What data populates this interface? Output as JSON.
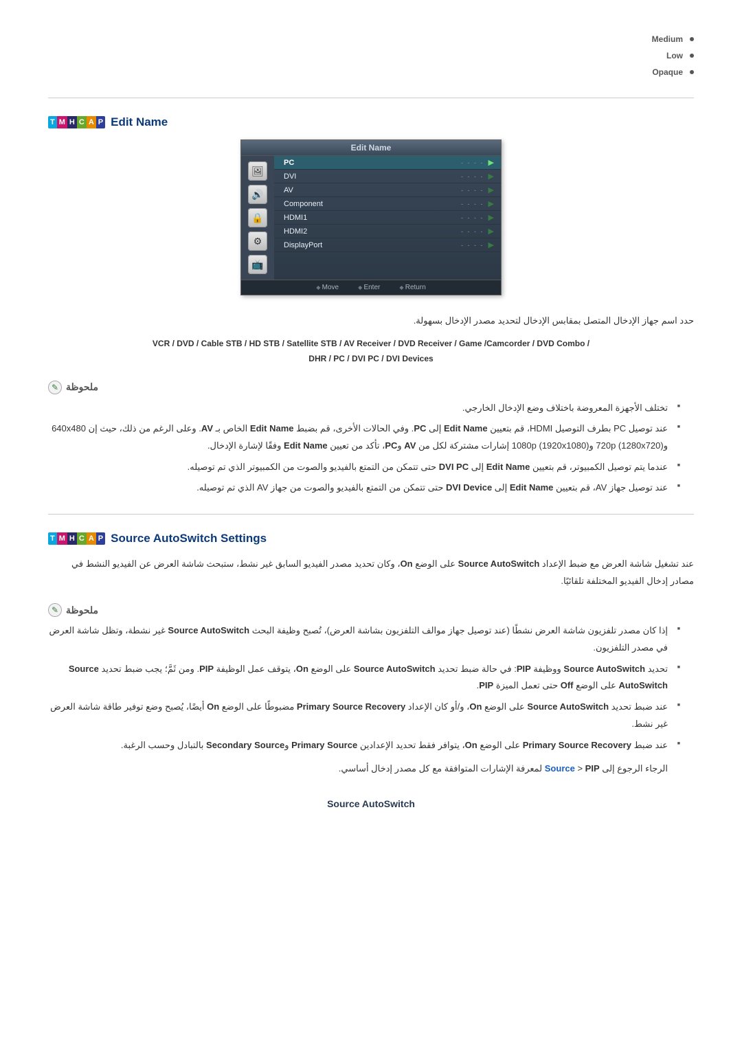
{
  "options": {
    "medium": "Medium",
    "low": "Low",
    "opaque": "Opaque"
  },
  "badges": {
    "t": "T",
    "m": "M",
    "h": "H",
    "c": "C",
    "a": "A",
    "p": "P"
  },
  "editName": {
    "title": "Edit Name",
    "osdTitle": "Edit Name",
    "rows": [
      {
        "name": "PC",
        "val": "- - - -"
      },
      {
        "name": "DVI",
        "val": "- - - -"
      },
      {
        "name": "AV",
        "val": "- - - -"
      },
      {
        "name": "Component",
        "val": "- - - -"
      },
      {
        "name": "HDMI1",
        "val": "- - - -"
      },
      {
        "name": "HDMI2",
        "val": "- - - -"
      },
      {
        "name": "DisplayPort",
        "val": "- - - -"
      }
    ],
    "foot": {
      "move": "Move",
      "enter": "Enter",
      "return": "Return"
    },
    "caption": "حدد اسم جهاز الإدخال المتصل بمقابس الإدخال لتحديد مصدر الإدخال بسهولة.",
    "devicesLine1": "VCR / DVD / Cable STB / HD STB / Satellite STB / AV Receiver / DVD Receiver / Game /Camcorder / DVD Combo /",
    "devicesLine2": "DHR / PC / DVI PC / DVI Devices"
  },
  "note1": {
    "label": "ملحوظة",
    "items": [
      "تختلف الأجهزة المعروضة باختلاف وضع الإدخال الخارجي.",
      "عند توصيل PC بطرف التوصيل HDMI، قم بتعيين <b>Edit Name</b> إلى <b>PC</b>. وفي الحالات الأخرى، قم بضبط <b>Edit Name</b> الخاص بـ <b>AV</b>. وعلى الرغم من ذلك، حيث إن 640x480 و(1280x720) 720p و(1920x1080) 1080p إشارات مشتركة لكل من <b>AV</b> و<b>PC</b>، تأكد من تعيين <b>Edit Name</b> وفقًا لإشارة الإدخال.",
      "عندما يتم توصيل الكمبيوتر، قم بتعيين <b>Edit Name</b> إلى <b>DVI PC</b> حتى تتمكن من التمتع بالفيديو والصوت من الكمبيوتر الذي تم توصيله.",
      "عند توصيل جهاز AV، قم بتعيين <b>Edit Name</b> إلى <b>DVI Device</b> حتى تتمكن من التمتع بالفيديو والصوت من جهاز AV الذي تم توصيله."
    ]
  },
  "autoSwitch": {
    "title": "Source AutoSwitch Settings",
    "para": "عند تشغيل شاشة العرض مع ضبط الإعداد <b>Source AutoSwitch</b> على الوضع <b>On</b>، وكان تحديد مصدر الفيديو السابق غير نشط، ستبحث شاشة العرض عن الفيديو النشط في مصادر إدخال الفيديو المختلفة تلقائيًا."
  },
  "note2": {
    "label": "ملحوظة",
    "items": [
      "إذا كان مصدر تلفزيون شاشة العرض نشطًا (عند توصيل جهاز موالف التلفزيون بشاشة العرض)، تُصبح وظيفة البحث <b>Source AutoSwitch</b> غير نشطة، وتظل شاشة العرض في مصدر التلفزيون.",
      "تحديد <b>Source AutoSwitch</b> ووظيفة <b>PIP</b>: في حالة ضبط تحديد <b>Source AutoSwitch</b> على الوضع <b>On</b>، يتوقف عمل الوظيفة <b>PIP</b>. ومن ثَمَّ؛ يجب ضبط تحديد <b>Source AutoSwitch</b> على الوضع <b>Off</b> حتى تعمل الميزة <b>PIP</b>.",
      "عند ضبط تحديد <b>Source AutoSwitch</b> على الوضع <b>On</b>، و/أو كان الإعداد <b>Primary Source Recovery</b> مضبوطًا على الوضع <b>On</b> أيضًا، يُصبح وضع توفير طاقة شاشة العرض غير نشط.",
      "عند ضبط <b>Primary Source Recovery</b> على الوضع <b>On</b>، يتوافر فقط تحديد الإعدادين <b>Primary Source</b> و<b>Secondary Source</b> بالتبادل وحسب الرغبة."
    ],
    "footerLine": "الرجاء الرجوع إلى <a>Source</a> &gt; <b>PIP</b> لمعرفة الإشارات المتوافقة مع كل مصدر إدخال أساسي."
  },
  "subHead": "Source AutoSwitch"
}
